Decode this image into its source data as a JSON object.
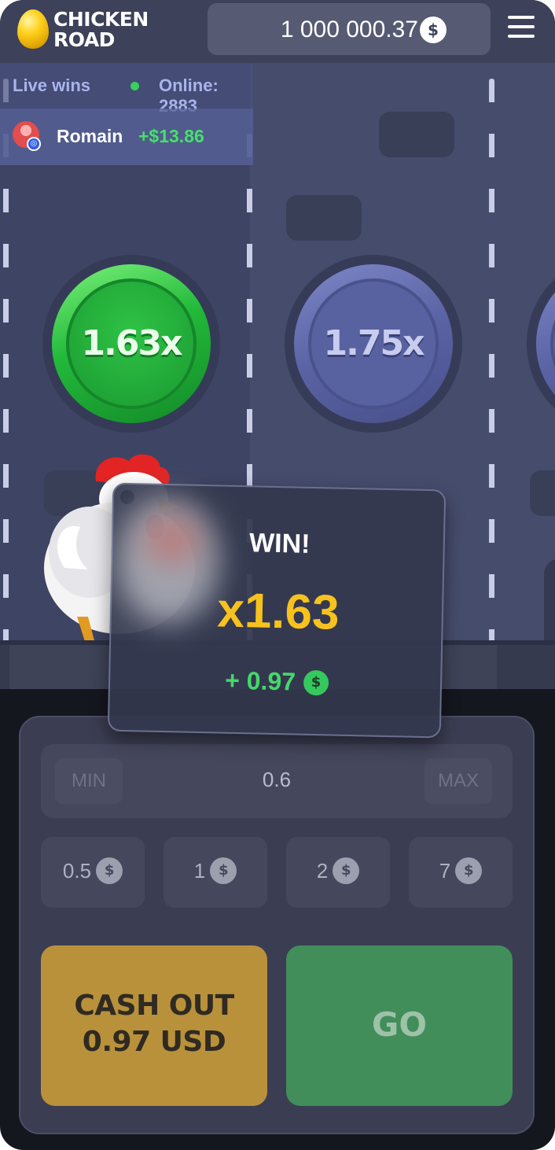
{
  "app": {
    "logo_line1": "CHICKEN",
    "logo_line2": "ROAD",
    "logo_icon": "golden-egg-icon"
  },
  "header": {
    "balance": "1 000 000.37",
    "currency_symbol": "$",
    "menu_icon": "hamburger-menu-icon"
  },
  "live": {
    "label": "Live wins",
    "online_label": "Online: 2883",
    "recent_win": {
      "name": "Romain",
      "amount": "+$13.86"
    }
  },
  "multipliers": [
    "1.63x",
    "1.75x"
  ],
  "win_popup": {
    "title": "WIN!",
    "multiplier": "x1.63",
    "gain": "+ 0.97",
    "currency_symbol": "$"
  },
  "bet": {
    "min_label": "MIN",
    "max_label": "MAX",
    "value": "0.6",
    "presets": [
      {
        "label": "0.5",
        "symbol": "$"
      },
      {
        "label": "1",
        "symbol": "$"
      },
      {
        "label": "2",
        "symbol": "$"
      },
      {
        "label": "7",
        "symbol": "$"
      }
    ]
  },
  "actions": {
    "cashout_line1": "CASH OUT",
    "cashout_line2": "0.97 USD",
    "go_label": "GO"
  },
  "colors": {
    "accent_green": "#45d86b",
    "win_gold": "#f7c21e",
    "cashout_button": "#b9913b",
    "go_button": "#418e5b"
  }
}
